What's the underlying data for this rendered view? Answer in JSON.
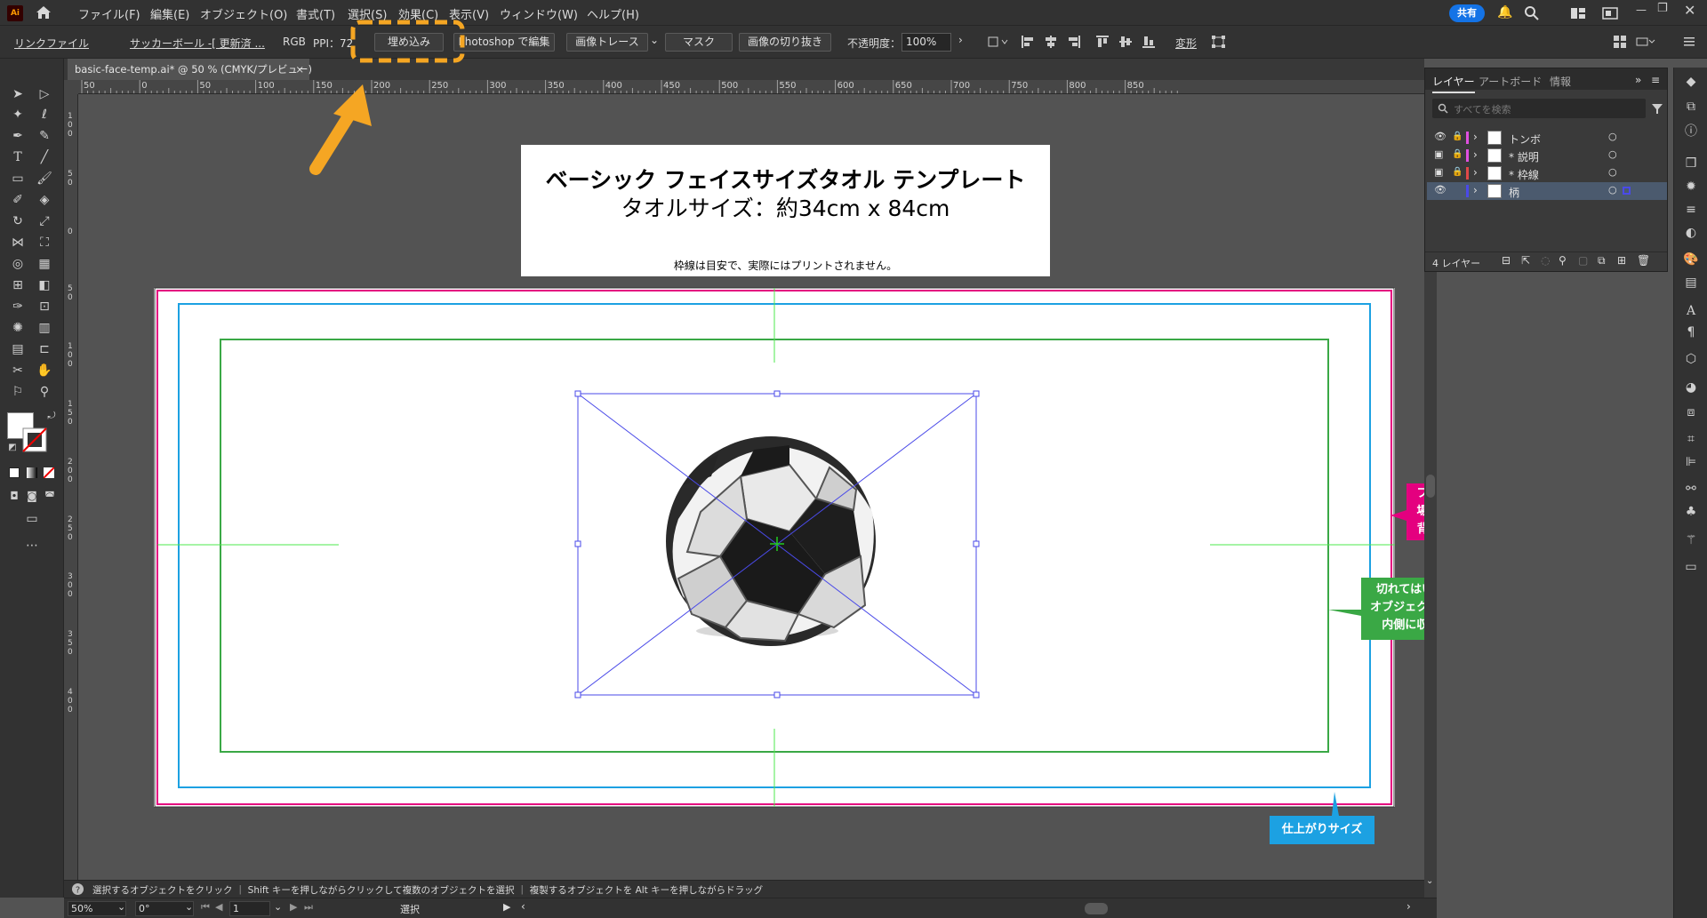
{
  "menubar": {
    "app_icon": "Ai",
    "items": [
      "ファイル(F)",
      "編集(E)",
      "オブジェクト(O)",
      "書式(T)",
      "選択(S)",
      "効果(C)",
      "表示(V)",
      "ウィンドウ(W)",
      "ヘルプ(H)"
    ],
    "share_label": "共有"
  },
  "control": {
    "link_file": "リンクファイル",
    "file_name": "サッカーボール -[ 更新済 ...",
    "color_mode": "RGB",
    "ppi": "PPI：72",
    "embed_button": "埋め込み",
    "photoshop_button": "Photoshop で編集",
    "image_trace_button": "画像トレース",
    "mask_button": "マスク",
    "crop_button": "画像の切り抜き",
    "opacity_label": "不透明度：",
    "opacity_value": "100%",
    "transform_label": "変形"
  },
  "document": {
    "tab_title": "basic-face-temp.ai* @ 50 % (CMYK/プレビュー)",
    "tab_close": "×"
  },
  "ruler": {
    "h_labels": [
      "50",
      "0",
      "50",
      "100",
      "150",
      "200",
      "250",
      "300",
      "350",
      "400",
      "450",
      "500",
      "550",
      "600",
      "650",
      "700",
      "750",
      "800",
      "850"
    ],
    "v_labels": [
      "1 0 0",
      "5 0",
      "0",
      "5 0",
      "1 0 0",
      "1 5 0",
      "2 0 0",
      "2 5 0",
      "3 0 0",
      "3 5 0",
      "4 0 0"
    ]
  },
  "template": {
    "title": "ベーシック フェイスサイズタオル テンプレート",
    "size": "タオルサイズ：約34cm x 84cm",
    "note": "枠線は目安で、実際にはプリントされません。"
  },
  "callouts": {
    "pink": [
      "フチなし印刷をご希望の",
      "場合は、ピンクの線まで",
      "背景を延ばしてください"
    ],
    "green": [
      "切れてはいけない文字や",
      "オブジェクトは緑の線より",
      "内側に収めてください"
    ],
    "blue": "仕上がりサイズ"
  },
  "colors": {
    "bleed_pink": "#e4007f",
    "trim_blue": "#1ca1e2",
    "safe_green": "#3aa845",
    "guide_green": "#4ee84e",
    "selection_blue": "#4a4ae8",
    "orange_highlight": "#f5a623"
  },
  "layers_panel": {
    "tabs": [
      "レイヤー",
      "アートボード",
      "情報"
    ],
    "search_placeholder": "すべてを検索",
    "rows": [
      {
        "name": "トンボ",
        "color": "#e04fe0"
      },
      {
        "name": "* 説明",
        "color": "#e04fe0"
      },
      {
        "name": "* 枠線",
        "color": "#e04848"
      },
      {
        "name": "柄",
        "color": "#4a4ae8"
      }
    ],
    "count": "4 レイヤー"
  },
  "status": {
    "hint": "選択するオブジェクトをクリック ｜ Shift キーを押しながらクリックして複数のオブジェクトを選択 ｜ 複製するオブジェクトを Alt キーを押しながらドラッグ",
    "zoom": "50%",
    "rotation": "0°",
    "artboard": "1",
    "tool": "選択"
  }
}
